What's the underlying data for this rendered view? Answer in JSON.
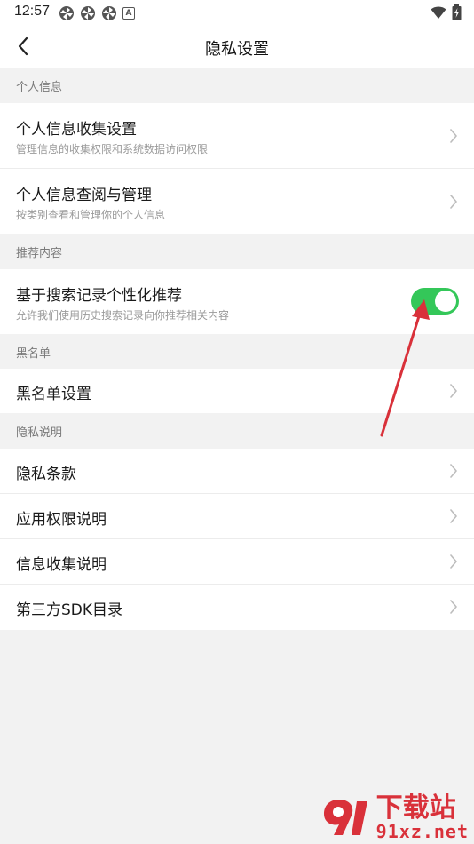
{
  "status_bar": {
    "time": "12:57",
    "notification_icons": [
      "pinwheel-icon",
      "pinwheel-icon",
      "pinwheel-icon",
      "a-badge-icon"
    ],
    "badge_letter": "A",
    "right_icons": [
      "wifi-icon",
      "battery-charging-icon"
    ]
  },
  "nav": {
    "title": "隐私设置",
    "back_icon": "chevron-left-icon"
  },
  "sections": {
    "personal_info": {
      "header": "个人信息",
      "items": [
        {
          "title": "个人信息收集设置",
          "subtitle": "管理信息的收集权限和系统数据访问权限"
        },
        {
          "title": "个人信息查阅与管理",
          "subtitle": "按类别查看和管理你的个人信息"
        }
      ]
    },
    "recommend": {
      "header": "推荐内容",
      "item": {
        "title": "基于搜索记录个性化推荐",
        "subtitle": "允许我们使用历史搜索记录向你推荐相关内容",
        "toggle_on": true
      }
    },
    "blacklist": {
      "header": "黑名单",
      "items": [
        {
          "title": "黑名单设置"
        }
      ]
    },
    "privacy_note": {
      "header": "隐私说明",
      "items": [
        {
          "title": "隐私条款"
        },
        {
          "title": "应用权限说明"
        },
        {
          "title": "信息收集说明"
        },
        {
          "title": "第三方SDK目录"
        }
      ]
    }
  },
  "colors": {
    "toggle_on": "#34c759",
    "annotation_arrow": "#d9313a",
    "watermark": "#d9313a"
  },
  "watermark": {
    "title": "下载站",
    "url": "91xz.net"
  }
}
